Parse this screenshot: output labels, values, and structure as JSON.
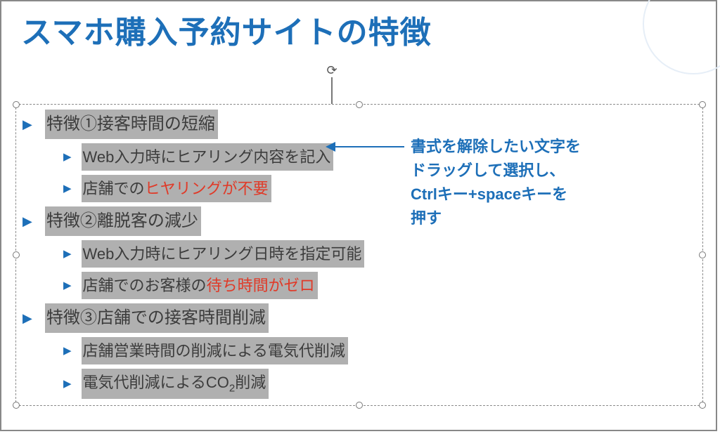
{
  "title": "スマホ購入予約サイトの特徴",
  "list": {
    "i0": {
      "text": "特徴①接客時間の短縮"
    },
    "i0a": {
      "text": "Web入力時にヒアリング内容を記入"
    },
    "i0b": {
      "pre": "店舗での",
      "red": "ヒヤリングが不要"
    },
    "i1": {
      "text": "特徴②離脱客の減少"
    },
    "i1a": {
      "text": "Web入力時にヒアリング日時を指定可能"
    },
    "i1b": {
      "pre": "店舗でのお客様の",
      "red": "待ち時間がゼロ"
    },
    "i2": {
      "text": "特徴③店舗での接客時間削減"
    },
    "i2a": {
      "text": "店舗営業時間の削減による電気代削減"
    },
    "i2b": {
      "pre": "電気代削減によるCO",
      "sub": "2",
      "post": "削減"
    }
  },
  "annotation": {
    "l1": "書式を解除したい文字を",
    "l2": "ドラッグして選択し、",
    "l3": "Ctrlキー+spaceキーを",
    "l4": "押す"
  }
}
